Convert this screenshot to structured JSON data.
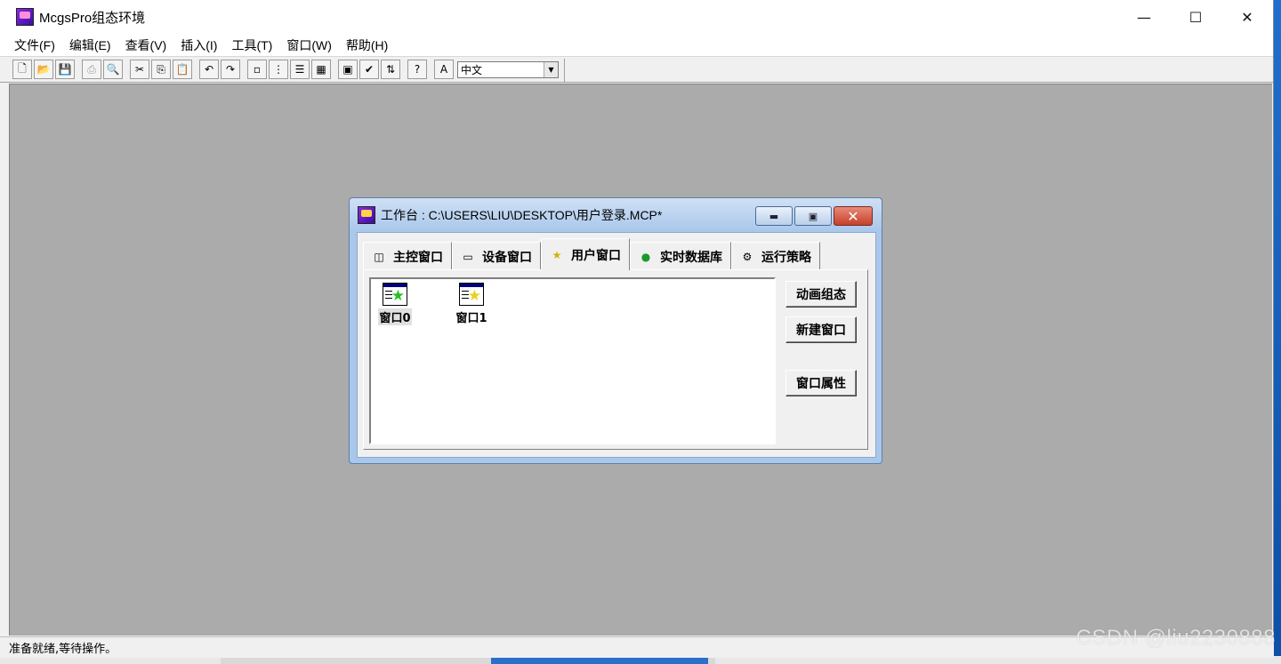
{
  "app": {
    "title": "McgsPro组态环境",
    "window_controls": {
      "minimize": "—",
      "maximize": "☐",
      "close": "✕"
    }
  },
  "menu": [
    "文件(F)",
    "编辑(E)",
    "查看(V)",
    "插入(I)",
    "工具(T)",
    "窗口(W)",
    "帮助(H)"
  ],
  "toolbar": {
    "buttons": [
      {
        "icon": "new-file-icon",
        "glyph": "🗋"
      },
      {
        "icon": "open-folder-icon",
        "glyph": "📂"
      },
      {
        "icon": "save-icon",
        "glyph": "💾"
      },
      {
        "icon": "print-icon",
        "glyph": "⎙"
      },
      {
        "icon": "print-preview-icon",
        "glyph": "🔍"
      },
      {
        "icon": "cut-icon",
        "glyph": "✂"
      },
      {
        "icon": "copy-icon",
        "glyph": "⎘"
      },
      {
        "icon": "paste-icon",
        "glyph": "📋"
      },
      {
        "icon": "undo-icon",
        "glyph": "↶"
      },
      {
        "icon": "redo-icon",
        "glyph": "↷"
      },
      {
        "icon": "large-icons-view-icon",
        "glyph": "▫"
      },
      {
        "icon": "small-icons-view-icon",
        "glyph": "⋮"
      },
      {
        "icon": "list-view-icon",
        "glyph": "☰"
      },
      {
        "icon": "details-view-icon",
        "glyph": "▦"
      },
      {
        "icon": "properties-icon",
        "glyph": "▣"
      },
      {
        "icon": "check-icon",
        "glyph": "✔"
      },
      {
        "icon": "sort-icon",
        "glyph": "⇅"
      },
      {
        "icon": "help-icon",
        "glyph": "?"
      },
      {
        "icon": "language-icon",
        "glyph": "A"
      }
    ],
    "language_value": "中文"
  },
  "workbench": {
    "title": "工作台 : C:\\USERS\\LIU\\DESKTOP\\用户登录.MCP*",
    "tabs": [
      {
        "label": "主控窗口",
        "icon": "main-window-icon",
        "glyph": "◫"
      },
      {
        "label": "设备窗口",
        "icon": "device-window-icon",
        "glyph": "▭"
      },
      {
        "label": "用户窗口",
        "icon": "user-window-icon",
        "glyph": "★"
      },
      {
        "label": "实时数据库",
        "icon": "database-icon",
        "glyph": "●"
      },
      {
        "label": "运行策略",
        "icon": "strategy-icon",
        "glyph": "⚙"
      }
    ],
    "active_tab": "用户窗口",
    "windows": [
      {
        "label": "窗口0",
        "star_color": "#22c022"
      },
      {
        "label": "窗口1",
        "star_color": "#f2e12a"
      }
    ],
    "actions": {
      "animation": "动画组态",
      "new_window": "新建窗口",
      "window_props": "窗口属性"
    }
  },
  "status": "准备就绪,等待操作。",
  "watermark": "CSDN @liu2230888"
}
